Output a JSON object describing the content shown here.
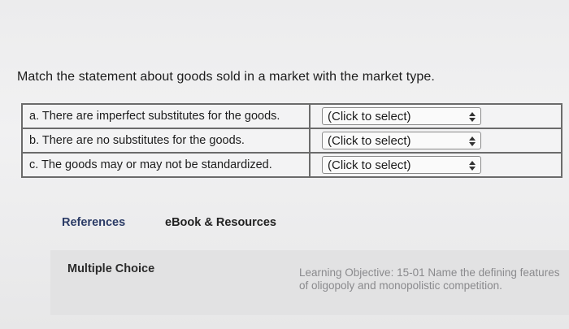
{
  "question": "Match the statement about goods sold in a market with the market type.",
  "rows": [
    {
      "statement": "a. There are imperfect substitutes for the goods.",
      "selection": "(Click to select)"
    },
    {
      "statement": "b. There are no substitutes for the goods.",
      "selection": "(Click to select)"
    },
    {
      "statement": "c. The goods may or may not be standardized.",
      "selection": "(Click to select)"
    }
  ],
  "tabs": {
    "references": "References",
    "ebook": "eBook & Resources"
  },
  "panel": {
    "type_label": "Multiple Choice",
    "objective": "Learning Objective: 15-01 Name the defining features of oligopoly and monopolistic competition."
  }
}
